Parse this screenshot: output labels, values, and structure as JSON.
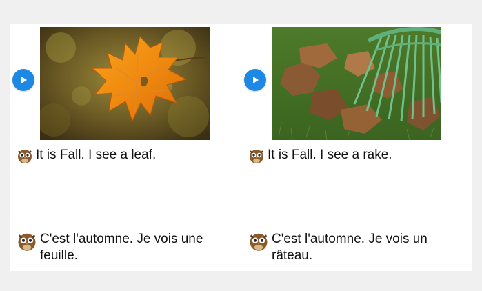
{
  "cards": [
    {
      "english": "It is Fall. I see a leaf.",
      "french": "C'est l'automne. Je vois une feuille.",
      "image_subject": "maple leaf"
    },
    {
      "english": "It is Fall. I see a rake.",
      "french": "C'est l'automne. Je vois un râteau.",
      "image_subject": "rake with leaves"
    }
  ],
  "colors": {
    "play_button": "#1e88e5",
    "background": "#f0f0f0",
    "card": "#ffffff"
  }
}
